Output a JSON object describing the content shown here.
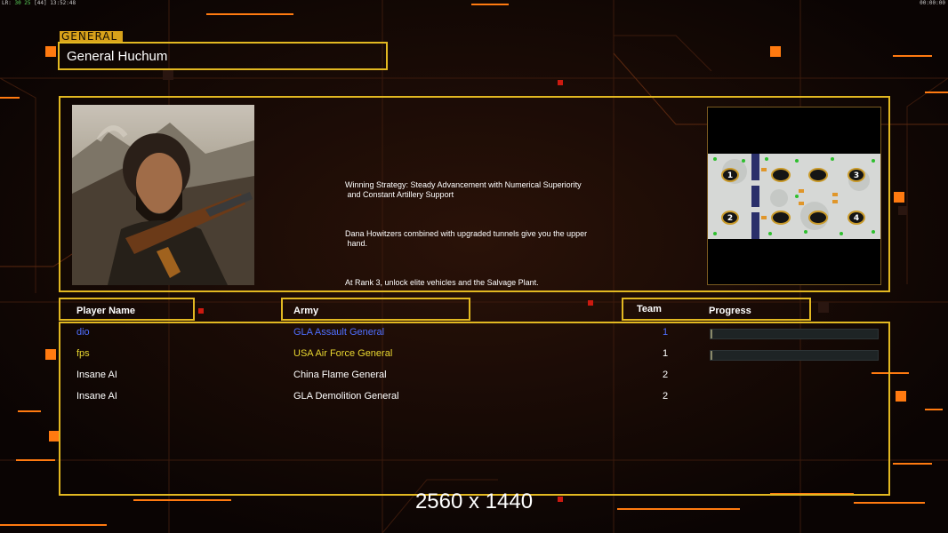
{
  "status_bar": {
    "left_prefix": "LR:",
    "left_green": "30 25",
    "left_middle": "[44]",
    "left_time": "13:52:48",
    "right_time": "00:00:00"
  },
  "general": {
    "section_tag": "GENERAL",
    "name": "General Huchum",
    "portrait_icon": "general-portrait-image",
    "description": [
      "Winning Strategy: Steady Advancement with Numerical Superiority\n and Constant Artillery Support",
      "Dana Howitzers combined with upgraded tunnels give you the upper\n hand.",
      "At Rank 3, unlock elite vehicles and the Salvage Plant."
    ],
    "map_slots": [
      "1",
      "2",
      "3",
      "4"
    ]
  },
  "roster": {
    "headers": {
      "player_name": "Player Name",
      "army": "Army",
      "team": "Team",
      "progress": "Progress"
    },
    "players": [
      {
        "name": "dio",
        "army": "GLA Assault General",
        "team": "1",
        "color": "#4f6fff",
        "team_color": "#4f6fff",
        "progress": 0.0,
        "show_progress": true
      },
      {
        "name": "fps",
        "army": "USA Air Force General",
        "team": "1",
        "color": "#e8d630",
        "team_color": "#ffffff",
        "progress": 0.01,
        "show_progress": true
      },
      {
        "name": "Insane AI",
        "army": "China Flame General",
        "team": "2",
        "color": "#ffffff",
        "team_color": "#ffffff",
        "progress": 0,
        "show_progress": false
      },
      {
        "name": "Insane AI",
        "army": "GLA Demolition General",
        "team": "2",
        "color": "#ffffff",
        "team_color": "#ffffff",
        "progress": 0,
        "show_progress": false
      }
    ]
  },
  "resolution_label": "2560 x 1440",
  "colors": {
    "frame": "#e2b821",
    "accent": "#ff8a1c",
    "background": "#0c0604"
  }
}
